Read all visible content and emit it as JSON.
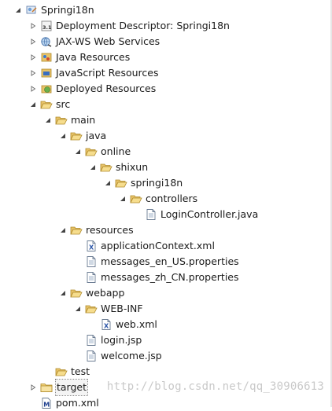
{
  "project_tree": {
    "items": [
      {
        "label": "Springi18n",
        "icon": "web-project-icon",
        "arrow": "expanded",
        "level": 0
      },
      {
        "label": "Deployment Descriptor: Springi18n",
        "icon": "deployment-descriptor-icon",
        "arrow": "collapsed",
        "level": 1
      },
      {
        "label": "JAX-WS Web Services",
        "icon": "web-services-icon",
        "arrow": "collapsed",
        "level": 1
      },
      {
        "label": "Java Resources",
        "icon": "java-resources-icon",
        "arrow": "collapsed",
        "level": 1
      },
      {
        "label": "JavaScript Resources",
        "icon": "javascript-resources-icon",
        "arrow": "collapsed",
        "level": 1
      },
      {
        "label": "Deployed Resources",
        "icon": "deployed-resources-icon",
        "arrow": "collapsed",
        "level": 1
      },
      {
        "label": "src",
        "icon": "folder-open-icon",
        "arrow": "expanded",
        "level": 1
      },
      {
        "label": "main",
        "icon": "folder-open-icon",
        "arrow": "expanded",
        "level": 2
      },
      {
        "label": "java",
        "icon": "folder-open-icon",
        "arrow": "expanded",
        "level": 3
      },
      {
        "label": "online",
        "icon": "folder-open-icon",
        "arrow": "expanded",
        "level": 4
      },
      {
        "label": "shixun",
        "icon": "folder-open-icon",
        "arrow": "expanded",
        "level": 5
      },
      {
        "label": "springi18n",
        "icon": "folder-open-icon",
        "arrow": "expanded",
        "level": 6
      },
      {
        "label": "controllers",
        "icon": "folder-open-icon",
        "arrow": "expanded",
        "level": 7
      },
      {
        "label": "LoginController.java",
        "icon": "file-icon",
        "arrow": "none",
        "level": 8
      },
      {
        "label": "resources",
        "icon": "folder-open-icon",
        "arrow": "expanded",
        "level": 3
      },
      {
        "label": "applicationContext.xml",
        "icon": "xml-file-icon",
        "arrow": "none",
        "level": 4
      },
      {
        "label": "messages_en_US.properties",
        "icon": "file-icon",
        "arrow": "none",
        "level": 4
      },
      {
        "label": "messages_zh_CN.properties",
        "icon": "file-icon",
        "arrow": "none",
        "level": 4
      },
      {
        "label": "webapp",
        "icon": "folder-open-icon",
        "arrow": "expanded",
        "level": 3
      },
      {
        "label": "WEB-INF",
        "icon": "folder-open-icon",
        "arrow": "expanded",
        "level": 4
      },
      {
        "label": "web.xml",
        "icon": "xml-file-icon",
        "arrow": "none",
        "level": 5
      },
      {
        "label": "login.jsp",
        "icon": "file-icon",
        "arrow": "none",
        "level": 4
      },
      {
        "label": "welcome.jsp",
        "icon": "file-icon",
        "arrow": "none",
        "level": 4
      },
      {
        "label": "test",
        "icon": "folder-open-icon",
        "arrow": "none",
        "level": 2
      },
      {
        "label": "target",
        "icon": "folder-closed-icon",
        "arrow": "collapsed",
        "level": 1,
        "highlighted": true
      },
      {
        "label": "pom.xml",
        "icon": "maven-pom-icon",
        "arrow": "none",
        "level": 1
      }
    ]
  },
  "watermark": "http://blog.csdn.net/qq_30906613"
}
